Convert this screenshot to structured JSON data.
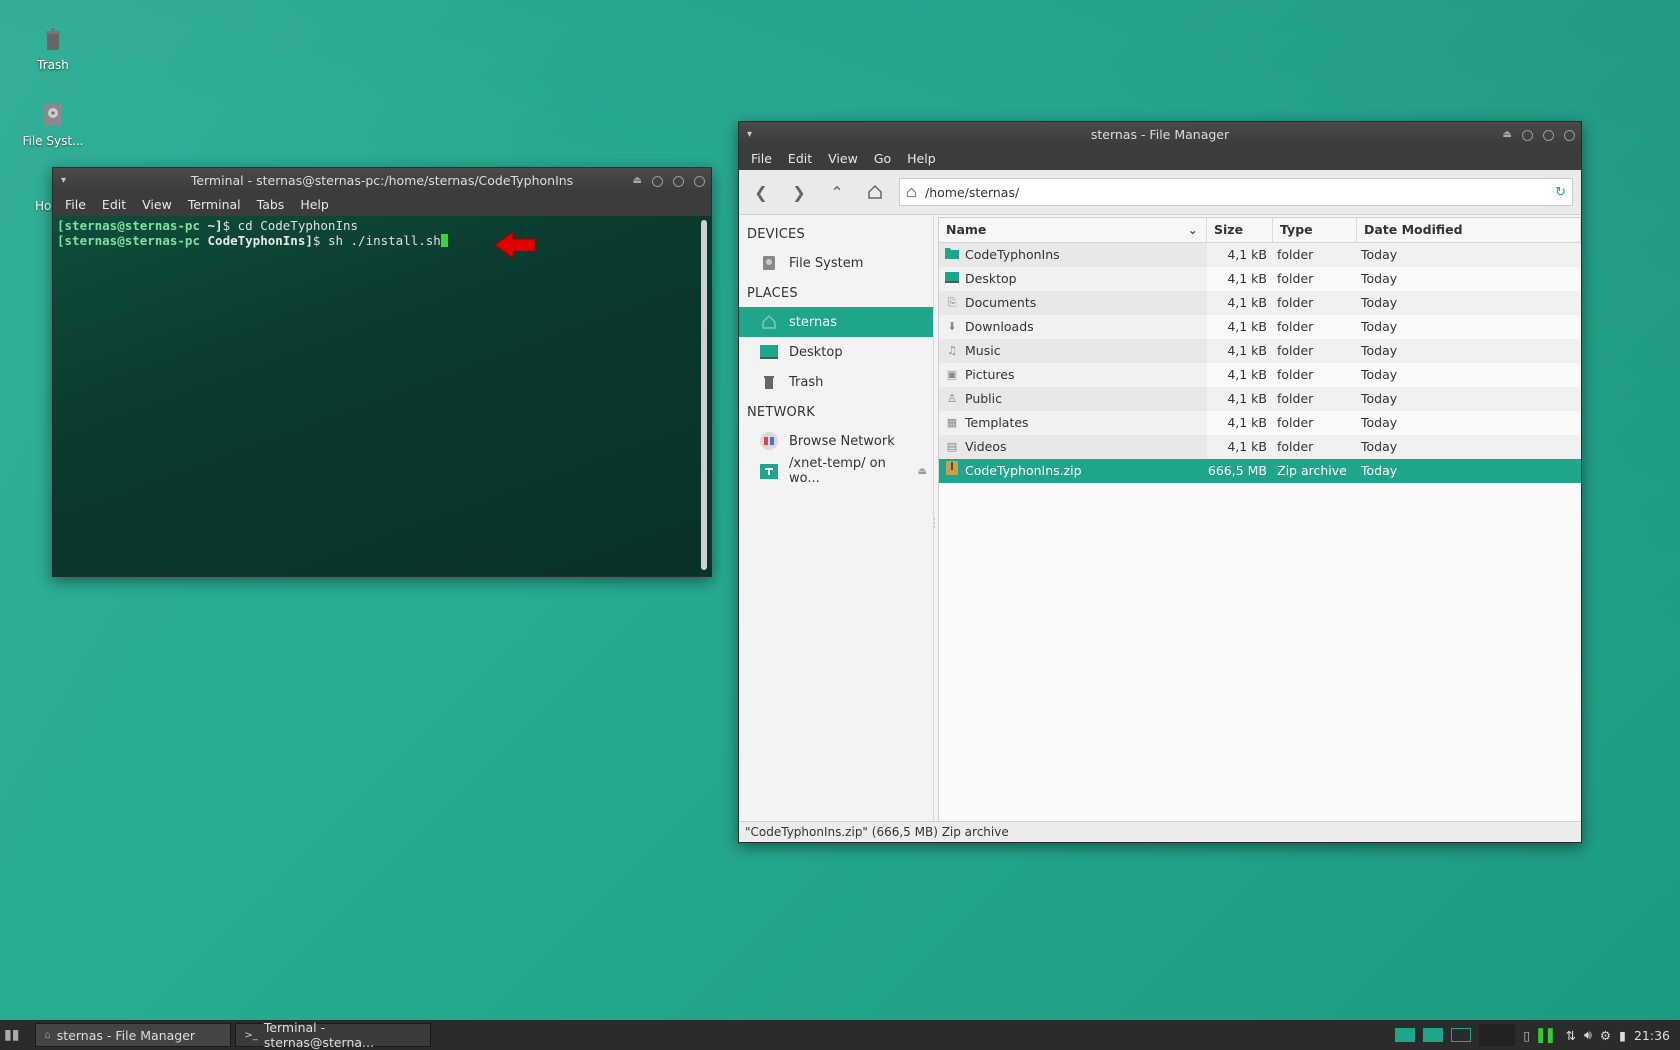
{
  "desktop": {
    "icons": [
      {
        "label": "Trash",
        "icon": "trash-icon"
      },
      {
        "label": "File Syst...",
        "icon": "harddisk-icon"
      },
      {
        "label": "Ho",
        "icon": "home-icon"
      }
    ]
  },
  "terminal": {
    "title": "Terminal - sternas@sternas-pc:/home/sternas/CodeTyphonIns",
    "menu": [
      "File",
      "Edit",
      "View",
      "Terminal",
      "Tabs",
      "Help"
    ],
    "lines": [
      {
        "user": "[sternas@sternas-pc",
        "dir": " ~]",
        "cmd": "$ cd CodeTyphonIns"
      },
      {
        "user": "[sternas@sternas-pc",
        "dir": " CodeTyphonIns]",
        "cmd": "$ sh ./install.sh"
      }
    ],
    "annotation_color": "#e00000"
  },
  "file_manager": {
    "title": "sternas - File Manager",
    "menu": [
      "File",
      "Edit",
      "View",
      "Go",
      "Help"
    ],
    "path": "/home/sternas/",
    "sidebar": {
      "devices_header": "DEVICES",
      "devices": [
        {
          "label": "File System",
          "icon": "harddisk-icon"
        }
      ],
      "places_header": "PLACES",
      "places": [
        {
          "label": "sternas",
          "icon": "home-icon",
          "selected": true
        },
        {
          "label": "Desktop",
          "icon": "desktop-icon"
        },
        {
          "label": "Trash",
          "icon": "trash-icon"
        }
      ],
      "network_header": "NETWORK",
      "network": [
        {
          "label": "Browse Network",
          "icon": "network-icon"
        },
        {
          "label": "/xnet-temp/ on wo...",
          "icon": "remote-folder-icon"
        }
      ]
    },
    "columns": [
      "Name",
      "Size",
      "Type",
      "Date Modified"
    ],
    "rows": [
      {
        "name": "CodeTyphonIns",
        "size": "4,1 kB",
        "type": "folder",
        "date": "Today",
        "icon": "folder-icon"
      },
      {
        "name": "Desktop",
        "size": "4,1 kB",
        "type": "folder",
        "date": "Today",
        "icon": "desktop-icon"
      },
      {
        "name": "Documents",
        "size": "4,1 kB",
        "type": "folder",
        "date": "Today",
        "icon": "documents-icon"
      },
      {
        "name": "Downloads",
        "size": "4,1 kB",
        "type": "folder",
        "date": "Today",
        "icon": "download-icon"
      },
      {
        "name": "Music",
        "size": "4,1 kB",
        "type": "folder",
        "date": "Today",
        "icon": "music-icon"
      },
      {
        "name": "Pictures",
        "size": "4,1 kB",
        "type": "folder",
        "date": "Today",
        "icon": "picture-icon"
      },
      {
        "name": "Public",
        "size": "4,1 kB",
        "type": "folder",
        "date": "Today",
        "icon": "public-icon"
      },
      {
        "name": "Templates",
        "size": "4,1 kB",
        "type": "folder",
        "date": "Today",
        "icon": "templates-icon"
      },
      {
        "name": "Videos",
        "size": "4,1 kB",
        "type": "folder",
        "date": "Today",
        "icon": "video-icon"
      },
      {
        "name": "CodeTyphonIns.zip",
        "size": "666,5 MB",
        "type": "Zip archive",
        "date": "Today",
        "icon": "archive-icon",
        "selected": true
      }
    ],
    "status": "\"CodeTyphonIns.zip\" (666,5 MB) Zip archive",
    "accent": "#1ea58a"
  },
  "taskbar": {
    "tasks": [
      {
        "label": "sternas - File Manager",
        "icon": "file-manager-icon"
      },
      {
        "label": "Terminal - sternas@sterna...",
        "icon": "terminal-icon"
      }
    ],
    "clock": "21:36"
  }
}
